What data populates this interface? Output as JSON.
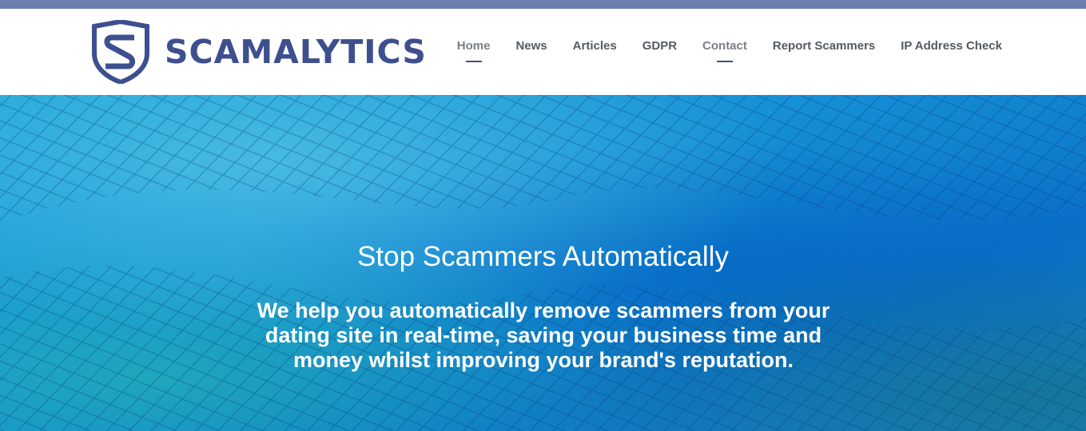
{
  "brand": {
    "name": "SCAMALYTICS",
    "logo_icon": "shield-s-icon",
    "color": "#3d4f8e"
  },
  "nav": {
    "items": [
      {
        "label": "Home",
        "active": true
      },
      {
        "label": "News",
        "active": false
      },
      {
        "label": "Articles",
        "active": false
      },
      {
        "label": "GDPR",
        "active": false
      },
      {
        "label": "Contact",
        "active": true
      },
      {
        "label": "Report Scammers",
        "active": false
      },
      {
        "label": "IP Address Check",
        "active": false
      }
    ]
  },
  "hero": {
    "title": "Stop Scammers Automatically",
    "subtitle": "We help you automatically remove scammers from your dating site in real-time, saving your business time and money whilst improving your brand's reputation.",
    "background_image": "blue-fishing-net-image"
  },
  "colors": {
    "top_bar": "#6a7fae",
    "nav_text": "#555a60",
    "hero_text": "#ffffff"
  }
}
